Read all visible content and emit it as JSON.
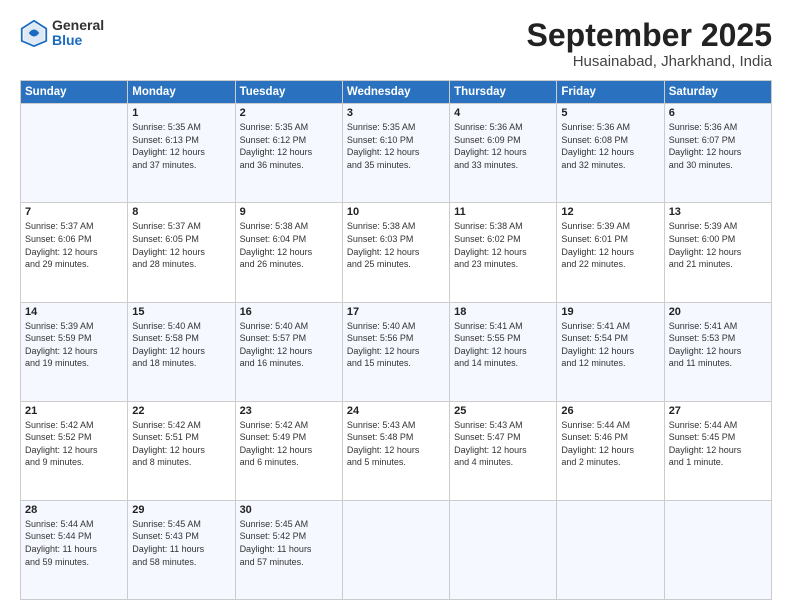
{
  "logo": {
    "general": "General",
    "blue": "Blue"
  },
  "title": "September 2025",
  "location": "Husainabad, Jharkhand, India",
  "headers": [
    "Sunday",
    "Monday",
    "Tuesday",
    "Wednesday",
    "Thursday",
    "Friday",
    "Saturday"
  ],
  "weeks": [
    [
      {
        "day": "",
        "info": ""
      },
      {
        "day": "1",
        "info": "Sunrise: 5:35 AM\nSunset: 6:13 PM\nDaylight: 12 hours\nand 37 minutes."
      },
      {
        "day": "2",
        "info": "Sunrise: 5:35 AM\nSunset: 6:12 PM\nDaylight: 12 hours\nand 36 minutes."
      },
      {
        "day": "3",
        "info": "Sunrise: 5:35 AM\nSunset: 6:10 PM\nDaylight: 12 hours\nand 35 minutes."
      },
      {
        "day": "4",
        "info": "Sunrise: 5:36 AM\nSunset: 6:09 PM\nDaylight: 12 hours\nand 33 minutes."
      },
      {
        "day": "5",
        "info": "Sunrise: 5:36 AM\nSunset: 6:08 PM\nDaylight: 12 hours\nand 32 minutes."
      },
      {
        "day": "6",
        "info": "Sunrise: 5:36 AM\nSunset: 6:07 PM\nDaylight: 12 hours\nand 30 minutes."
      }
    ],
    [
      {
        "day": "7",
        "info": "Sunrise: 5:37 AM\nSunset: 6:06 PM\nDaylight: 12 hours\nand 29 minutes."
      },
      {
        "day": "8",
        "info": "Sunrise: 5:37 AM\nSunset: 6:05 PM\nDaylight: 12 hours\nand 28 minutes."
      },
      {
        "day": "9",
        "info": "Sunrise: 5:38 AM\nSunset: 6:04 PM\nDaylight: 12 hours\nand 26 minutes."
      },
      {
        "day": "10",
        "info": "Sunrise: 5:38 AM\nSunset: 6:03 PM\nDaylight: 12 hours\nand 25 minutes."
      },
      {
        "day": "11",
        "info": "Sunrise: 5:38 AM\nSunset: 6:02 PM\nDaylight: 12 hours\nand 23 minutes."
      },
      {
        "day": "12",
        "info": "Sunrise: 5:39 AM\nSunset: 6:01 PM\nDaylight: 12 hours\nand 22 minutes."
      },
      {
        "day": "13",
        "info": "Sunrise: 5:39 AM\nSunset: 6:00 PM\nDaylight: 12 hours\nand 21 minutes."
      }
    ],
    [
      {
        "day": "14",
        "info": "Sunrise: 5:39 AM\nSunset: 5:59 PM\nDaylight: 12 hours\nand 19 minutes."
      },
      {
        "day": "15",
        "info": "Sunrise: 5:40 AM\nSunset: 5:58 PM\nDaylight: 12 hours\nand 18 minutes."
      },
      {
        "day": "16",
        "info": "Sunrise: 5:40 AM\nSunset: 5:57 PM\nDaylight: 12 hours\nand 16 minutes."
      },
      {
        "day": "17",
        "info": "Sunrise: 5:40 AM\nSunset: 5:56 PM\nDaylight: 12 hours\nand 15 minutes."
      },
      {
        "day": "18",
        "info": "Sunrise: 5:41 AM\nSunset: 5:55 PM\nDaylight: 12 hours\nand 14 minutes."
      },
      {
        "day": "19",
        "info": "Sunrise: 5:41 AM\nSunset: 5:54 PM\nDaylight: 12 hours\nand 12 minutes."
      },
      {
        "day": "20",
        "info": "Sunrise: 5:41 AM\nSunset: 5:53 PM\nDaylight: 12 hours\nand 11 minutes."
      }
    ],
    [
      {
        "day": "21",
        "info": "Sunrise: 5:42 AM\nSunset: 5:52 PM\nDaylight: 12 hours\nand 9 minutes."
      },
      {
        "day": "22",
        "info": "Sunrise: 5:42 AM\nSunset: 5:51 PM\nDaylight: 12 hours\nand 8 minutes."
      },
      {
        "day": "23",
        "info": "Sunrise: 5:42 AM\nSunset: 5:49 PM\nDaylight: 12 hours\nand 6 minutes."
      },
      {
        "day": "24",
        "info": "Sunrise: 5:43 AM\nSunset: 5:48 PM\nDaylight: 12 hours\nand 5 minutes."
      },
      {
        "day": "25",
        "info": "Sunrise: 5:43 AM\nSunset: 5:47 PM\nDaylight: 12 hours\nand 4 minutes."
      },
      {
        "day": "26",
        "info": "Sunrise: 5:44 AM\nSunset: 5:46 PM\nDaylight: 12 hours\nand 2 minutes."
      },
      {
        "day": "27",
        "info": "Sunrise: 5:44 AM\nSunset: 5:45 PM\nDaylight: 12 hours\nand 1 minute."
      }
    ],
    [
      {
        "day": "28",
        "info": "Sunrise: 5:44 AM\nSunset: 5:44 PM\nDaylight: 11 hours\nand 59 minutes."
      },
      {
        "day": "29",
        "info": "Sunrise: 5:45 AM\nSunset: 5:43 PM\nDaylight: 11 hours\nand 58 minutes."
      },
      {
        "day": "30",
        "info": "Sunrise: 5:45 AM\nSunset: 5:42 PM\nDaylight: 11 hours\nand 57 minutes."
      },
      {
        "day": "",
        "info": ""
      },
      {
        "day": "",
        "info": ""
      },
      {
        "day": "",
        "info": ""
      },
      {
        "day": "",
        "info": ""
      }
    ]
  ]
}
